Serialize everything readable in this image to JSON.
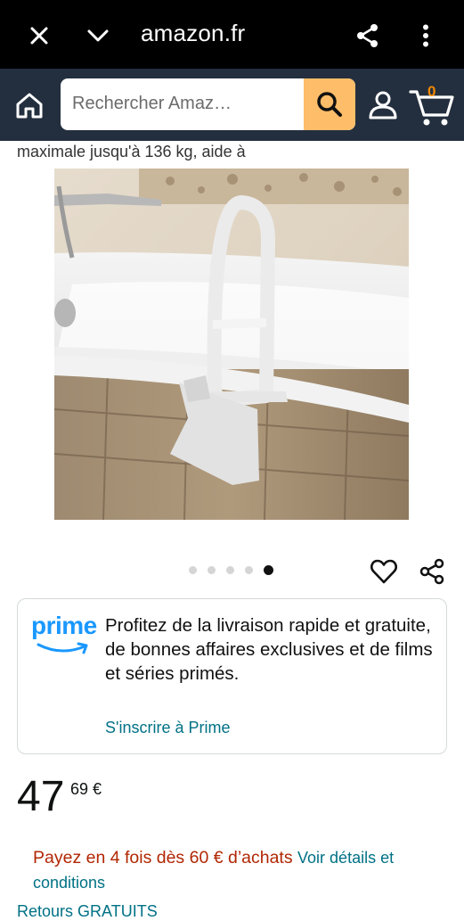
{
  "browser": {
    "domain": "amazon.fr",
    "icons": [
      "close-icon",
      "chevron-down-icon",
      "share-icon",
      "more-vert-icon"
    ]
  },
  "amazon_header": {
    "search_placeholder": "Rechercher Amaz…",
    "cart_count": "0",
    "icons": [
      "home-icon",
      "search-icon",
      "account-icon",
      "cart-icon"
    ],
    "colors": {
      "bar": "#232f3e",
      "search_button": "#febd69",
      "cart_count": "#f08804"
    }
  },
  "product": {
    "title_tail": "maximale jusqu'à 136 kg, aide à",
    "gallery": {
      "total_images": 5,
      "active_index": 5
    }
  },
  "prime": {
    "logo_text": "prime",
    "message": "Profitez de la livraison rapide et gratuite, de bonnes affaires exclusives et de films et séries primés.",
    "cta": "S'inscrire à Prime",
    "colors": {
      "logo": "#1a98ff",
      "link": "#007185"
    }
  },
  "price": {
    "whole": "47",
    "fraction": "69 €"
  },
  "installments": {
    "text": "Payez en 4 fois dès 60 € d’achats",
    "link": "Voir détails et conditions",
    "colors": {
      "text": "#b12704",
      "link": "#007185"
    }
  },
  "bottom_partial": "Retours GRATUITS"
}
